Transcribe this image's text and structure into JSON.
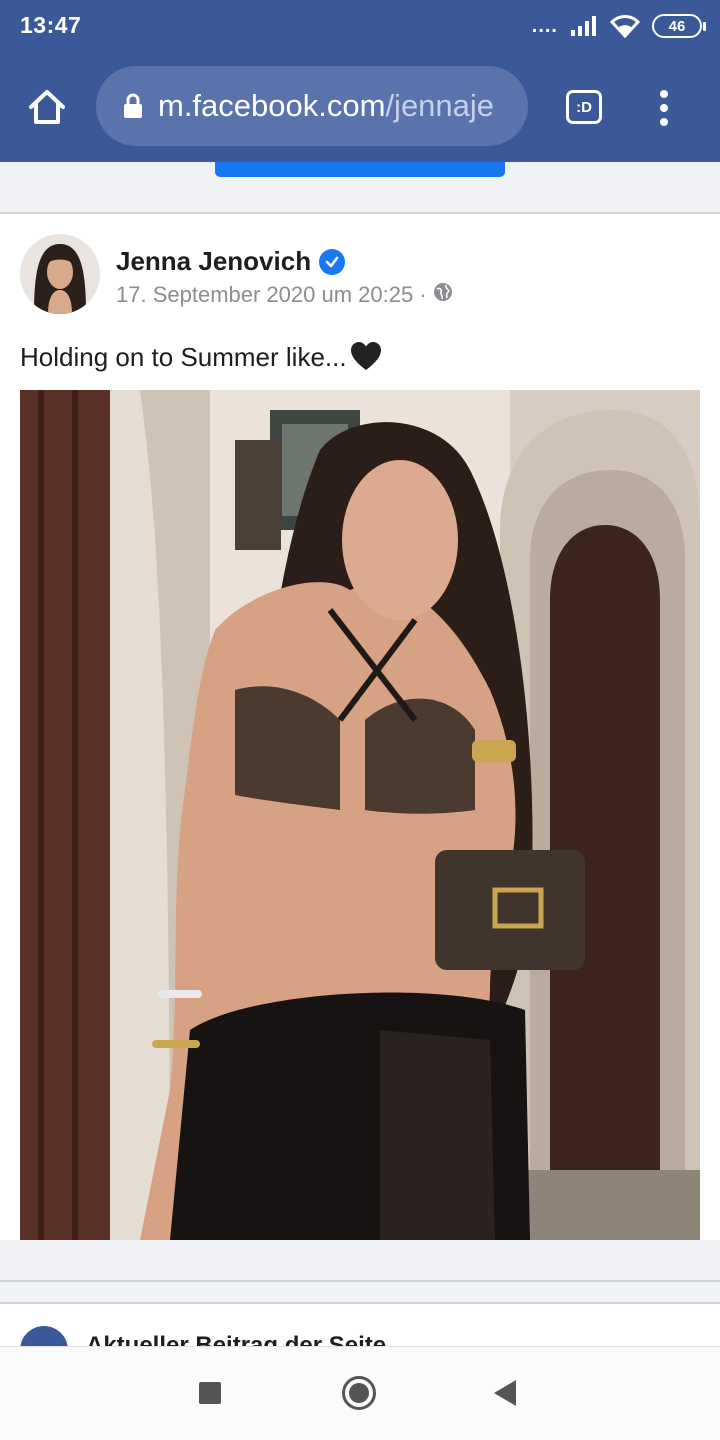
{
  "status_bar": {
    "time": "13:47",
    "signal_dots": "....",
    "battery": "46"
  },
  "browser": {
    "url_domain": "m.facebook.com",
    "url_path": "/jennaje",
    "tab_switcher_label": ":D",
    "icons": {
      "home": "home-icon",
      "lock": "lock-icon",
      "menu": "more-vert-icon"
    }
  },
  "post": {
    "author": "Jenna Jenovich",
    "verified": true,
    "timestamp": "17. September 2020 um 20:25",
    "meta_separator": "·",
    "audience_icon": "globe-icon",
    "caption": "Holding on to Summer like...",
    "caption_emoji": "black-heart",
    "photo_alt": "Post photo"
  },
  "next_section": {
    "label": "Aktueller Beitrag der Seite"
  },
  "nav_bar": {
    "recent": "recents-icon",
    "home": "home-circle-icon",
    "back": "back-icon"
  },
  "colors": {
    "brand_blue": "#3b5998",
    "link_blue": "#1877f2",
    "text_primary": "#1c1e21",
    "text_secondary": "#8a8d91"
  }
}
